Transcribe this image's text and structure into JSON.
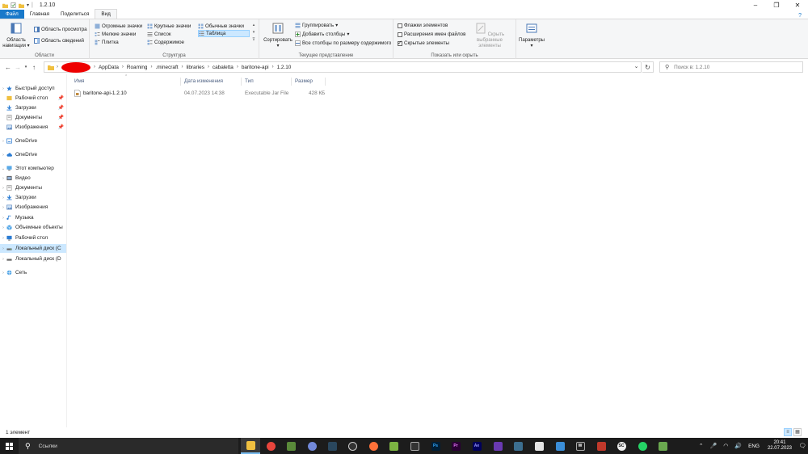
{
  "window": {
    "title": "1.2.10"
  },
  "tabs": [
    {
      "label": "Файл"
    },
    {
      "label": "Главная"
    },
    {
      "label": "Поделиться"
    },
    {
      "label": "Вид"
    }
  ],
  "ribbon": {
    "areas": {
      "nav_pane_label": "Область навигации",
      "preview_pane": "Область просмотра",
      "details_pane": "Область сведений",
      "group_label": "Области"
    },
    "layout": {
      "items": [
        {
          "label": "Огромные значки"
        },
        {
          "label": "Крупные значки"
        },
        {
          "label": "Обычные значки"
        },
        {
          "label": "Мелкие значки"
        },
        {
          "label": "Список"
        },
        {
          "label": "Таблица"
        },
        {
          "label": "Плитка"
        },
        {
          "label": "Содержимое"
        }
      ],
      "group_label": "Структура"
    },
    "current_view": {
      "sort_label": "Сортировать",
      "group_by": "Группировать",
      "add_columns": "Добавить столбцы",
      "fit_columns": "Все столбцы по размеру содержимого",
      "group_label": "Текущее представление"
    },
    "show_hide": {
      "item_checkboxes": "Флажки элементов",
      "file_extensions": "Расширения имен файлов",
      "hidden_items": "Скрытые элементы",
      "hide_selected": "Скрыть выбранные элементы",
      "group_label": "Показать или скрыть"
    },
    "options_label": "Параметры"
  },
  "address": {
    "crumbs": [
      "AppData",
      "Roaming",
      ".minecraft",
      "libraries",
      "cabaletta",
      "baritone-api",
      "1.2.10"
    ],
    "search_placeholder": "Поиск в: 1.2.10"
  },
  "nav": {
    "quick_access": "Быстрый доступ",
    "quick_items": [
      {
        "label": "Рабочий стол"
      },
      {
        "label": "Загрузки"
      },
      {
        "label": "Документы"
      },
      {
        "label": "Изображения"
      }
    ],
    "onedrive_1": "OneDrive",
    "onedrive_2": "OneDrive",
    "this_pc": "Этот компьютер",
    "pc_items": [
      {
        "label": "Видео"
      },
      {
        "label": "Документы"
      },
      {
        "label": "Загрузки"
      },
      {
        "label": "Изображения"
      },
      {
        "label": "Музыка"
      },
      {
        "label": "Объемные объекты"
      },
      {
        "label": "Рабочий стол"
      },
      {
        "label": "Локальный диск (C"
      },
      {
        "label": "Локальный диск (D"
      }
    ],
    "network": "Сеть"
  },
  "columns": {
    "name": "Имя",
    "date": "Дата изменения",
    "type": "Тип",
    "size": "Размер"
  },
  "files": [
    {
      "name": "baritone-api-1.2.10",
      "date": "04.07.2023 14:38",
      "type": "Executable Jar File",
      "size": "428 КБ"
    }
  ],
  "status": {
    "count": "1 элемент"
  },
  "taskbar": {
    "search": "Ссылки",
    "lang": "ENG",
    "time": "20:41",
    "date": "22.07.2023"
  },
  "colors": {
    "accent": "#1979ca",
    "selection": "#cce8ff",
    "taskbar": "#1c1c1c",
    "redaction": "#e00000"
  }
}
